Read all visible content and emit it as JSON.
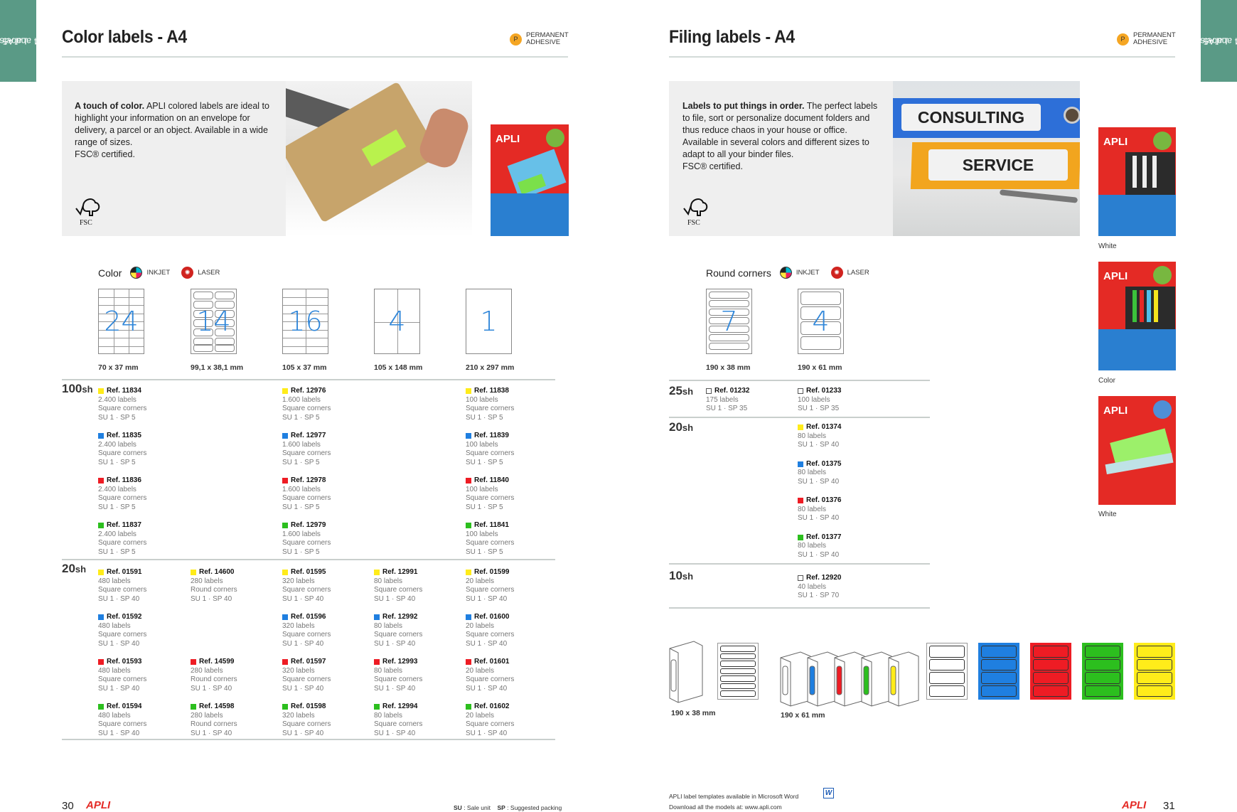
{
  "side_tabs": {
    "left": [
      "Labels",
      "A4 and A5"
    ],
    "right": [
      "Labels",
      "A4 and A5"
    ]
  },
  "colors": {
    "yellow": "#ffec1a",
    "blue": "#1f7fe0",
    "red": "#ee1c24",
    "green": "#2cbf1e",
    "accent_green": "#5a9a86",
    "brand_red": "#e42a25",
    "number_blue": "#2f86d9"
  },
  "left_page": {
    "title": "Color labels - A4",
    "adhesive_badge": {
      "icon": "P",
      "line1": "PERMANENT",
      "line2": "ADHESIVE"
    },
    "hero": {
      "lead": "A touch of color.",
      "body": " APLI colored labels are ideal to highlight your information on an envelope for delivery, a parcel or an object. Available in a wide range of sizes.",
      "certified": "FSC® certified.",
      "fsc_text": "FSC",
      "pack_brand": "APLI"
    },
    "section": {
      "label": "Color",
      "inkjet": "INKJET",
      "laser": "LASER"
    },
    "formats": [
      {
        "count": "24",
        "size": "70 x 37 mm"
      },
      {
        "count": "14",
        "size": "99,1 x 38,1 mm"
      },
      {
        "count": "16",
        "size": "105 x 37 mm"
      },
      {
        "count": "4",
        "size": "105 x 148 mm"
      },
      {
        "count": "1",
        "size": "210 x 297 mm"
      }
    ],
    "groups": [
      {
        "sheets": "100",
        "unit": "sh",
        "columns": [
          [
            {
              "color": "yellow",
              "ref": "Ref. 11834",
              "labels": "2.400 labels",
              "corners": "Square corners",
              "pack": "SU 1 · SP 5"
            },
            {
              "color": "blue",
              "ref": "Ref. 11835",
              "labels": "2.400 labels",
              "corners": "Square corners",
              "pack": "SU 1 · SP 5"
            },
            {
              "color": "red",
              "ref": "Ref. 11836",
              "labels": "2.400 labels",
              "corners": "Square corners",
              "pack": "SU 1 · SP 5"
            },
            {
              "color": "green",
              "ref": "Ref. 11837",
              "labels": "2.400 labels",
              "corners": "Square corners",
              "pack": "SU 1 · SP 5"
            }
          ],
          [],
          [
            {
              "color": "yellow",
              "ref": "Ref. 12976",
              "labels": "1.600 labels",
              "corners": "Square corners",
              "pack": "SU 1 · SP 5"
            },
            {
              "color": "blue",
              "ref": "Ref. 12977",
              "labels": "1.600 labels",
              "corners": "Square corners",
              "pack": "SU 1 · SP 5"
            },
            {
              "color": "red",
              "ref": "Ref. 12978",
              "labels": "1.600 labels",
              "corners": "Square corners",
              "pack": "SU 1 · SP 5"
            },
            {
              "color": "green",
              "ref": "Ref. 12979",
              "labels": "1.600 labels",
              "corners": "Square corners",
              "pack": "SU 1 · SP 5"
            }
          ],
          [],
          [
            {
              "color": "yellow",
              "ref": "Ref. 11838",
              "labels": "100 labels",
              "corners": "Square corners",
              "pack": "SU 1 · SP 5"
            },
            {
              "color": "blue",
              "ref": "Ref. 11839",
              "labels": "100 labels",
              "corners": "Square corners",
              "pack": "SU 1 · SP 5"
            },
            {
              "color": "red",
              "ref": "Ref. 11840",
              "labels": "100 labels",
              "corners": "Square corners",
              "pack": "SU 1 · SP 5"
            },
            {
              "color": "green",
              "ref": "Ref. 11841",
              "labels": "100 labels",
              "corners": "Square corners",
              "pack": "SU 1 · SP 5"
            }
          ]
        ]
      },
      {
        "sheets": "20",
        "unit": "sh",
        "columns": [
          [
            {
              "color": "yellow",
              "ref": "Ref. 01591",
              "labels": "480 labels",
              "corners": "Square corners",
              "pack": "SU 1 · SP 40"
            },
            {
              "color": "blue",
              "ref": "Ref. 01592",
              "labels": "480 labels",
              "corners": "Square corners",
              "pack": "SU 1 · SP 40"
            },
            {
              "color": "red",
              "ref": "Ref. 01593",
              "labels": "480 labels",
              "corners": "Square corners",
              "pack": "SU 1 · SP 40"
            },
            {
              "color": "green",
              "ref": "Ref. 01594",
              "labels": "480 labels",
              "corners": "Square corners",
              "pack": "SU 1 · SP 40"
            }
          ],
          [
            {
              "color": "yellow",
              "ref": "Ref. 14600",
              "labels": "280 labels",
              "corners": "Round corners",
              "pack": "SU 1 · SP 40"
            },
            null,
            {
              "color": "red",
              "ref": "Ref. 14599",
              "labels": "280 labels",
              "corners": "Round corners",
              "pack": "SU 1 · SP 40"
            },
            {
              "color": "green",
              "ref": "Ref. 14598",
              "labels": "280 labels",
              "corners": "Round corners",
              "pack": "SU 1 · SP 40"
            }
          ],
          [
            {
              "color": "yellow",
              "ref": "Ref. 01595",
              "labels": "320 labels",
              "corners": "Square corners",
              "pack": "SU 1 · SP 40"
            },
            {
              "color": "blue",
              "ref": "Ref. 01596",
              "labels": "320 labels",
              "corners": "Square corners",
              "pack": "SU 1 · SP 40"
            },
            {
              "color": "red",
              "ref": "Ref. 01597",
              "labels": "320 labels",
              "corners": "Square corners",
              "pack": "SU 1 · SP 40"
            },
            {
              "color": "green",
              "ref": "Ref. 01598",
              "labels": "320 labels",
              "corners": "Square corners",
              "pack": "SU 1 · SP 40"
            }
          ],
          [
            {
              "color": "yellow",
              "ref": "Ref. 12991",
              "labels": "80 labels",
              "corners": "Square corners",
              "pack": "SU 1 · SP 40"
            },
            {
              "color": "blue",
              "ref": "Ref. 12992",
              "labels": "80 labels",
              "corners": "Square corners",
              "pack": "SU 1 · SP 40"
            },
            {
              "color": "red",
              "ref": "Ref. 12993",
              "labels": "80 labels",
              "corners": "Square corners",
              "pack": "SU 1 · SP 40"
            },
            {
              "color": "green",
              "ref": "Ref. 12994",
              "labels": "80 labels",
              "corners": "Square corners",
              "pack": "SU 1 · SP 40"
            }
          ],
          [
            {
              "color": "yellow",
              "ref": "Ref. 01599",
              "labels": "20 labels",
              "corners": "Square corners",
              "pack": "SU 1 · SP 40"
            },
            {
              "color": "blue",
              "ref": "Ref. 01600",
              "labels": "20 labels",
              "corners": "Square corners",
              "pack": "SU 1 · SP 40"
            },
            {
              "color": "red",
              "ref": "Ref. 01601",
              "labels": "20 labels",
              "corners": "Square corners",
              "pack": "SU 1 · SP 40"
            },
            {
              "color": "green",
              "ref": "Ref. 01602",
              "labels": "20 labels",
              "corners": "Square corners",
              "pack": "SU 1 · SP 40"
            }
          ]
        ]
      }
    ],
    "footer": {
      "page_number": "30",
      "brand": "APLI",
      "su_key": "SU",
      "su_text": ": Sale unit",
      "sp_key": "SP",
      "sp_text": ": Suggested packing"
    }
  },
  "right_page": {
    "title": "Filing labels - A4",
    "adhesive_badge": {
      "icon": "P",
      "line1": "PERMANENT",
      "line2": "ADHESIVE"
    },
    "hero": {
      "lead": "Labels to put things in order.",
      "body": " The perfect labels to file, sort or personalize document folders and thus reduce chaos in your house or office. Available in several colors and different sizes to adapt to all your binder files.",
      "certified": "FSC® certified.",
      "fsc_text": "FSC",
      "photo_label_1": "CONSULTING",
      "photo_label_2": "SERVICE"
    },
    "packs": [
      {
        "brand": "APLI",
        "caption": "White"
      },
      {
        "brand": "APLI",
        "caption": "Color"
      },
      {
        "brand": "APLI",
        "caption": "White"
      }
    ],
    "section": {
      "label": "Round corners",
      "inkjet": "INKJET",
      "laser": "LASER"
    },
    "formats": [
      {
        "count": "7",
        "size": "190 x 38 mm"
      },
      {
        "count": "4",
        "size": "190 x 61 mm"
      }
    ],
    "groups": [
      {
        "sheets": "25",
        "unit": "sh",
        "columns": [
          [
            {
              "color": "white",
              "ref": "Ref. 01232",
              "labels": "175 labels",
              "pack": "SU 1 · SP 35"
            }
          ],
          [
            {
              "color": "white",
              "ref": "Ref. 01233",
              "labels": "100 labels",
              "pack": "SU 1 · SP 35"
            }
          ]
        ]
      },
      {
        "sheets": "20",
        "unit": "sh",
        "columns": [
          [],
          [
            {
              "color": "yellow",
              "ref": "Ref. 01374",
              "labels": "80 labels",
              "pack": "SU 1 · SP 40"
            },
            {
              "color": "blue",
              "ref": "Ref. 01375",
              "labels": "80 labels",
              "pack": "SU 1 · SP 40"
            },
            {
              "color": "red",
              "ref": "Ref. 01376",
              "labels": "80 labels",
              "pack": "SU 1 · SP 40"
            },
            {
              "color": "green",
              "ref": "Ref. 01377",
              "labels": "80 labels",
              "pack": "SU 1 · SP 40"
            }
          ]
        ]
      },
      {
        "sheets": "10",
        "unit": "sh",
        "columns": [
          [],
          [
            {
              "color": "white",
              "ref": "Ref. 12920",
              "labels": "40 labels",
              "pack": "SU 1 · SP 70"
            }
          ]
        ]
      }
    ],
    "illustrations": {
      "size_a": "190 x 38 mm",
      "size_b": "190 x 61 mm",
      "sheet_colors": [
        "white",
        "blue",
        "red",
        "green",
        "yellow"
      ]
    },
    "footer": {
      "page_number": "31",
      "brand": "APLI",
      "templates_line": "APLI label templates available in Microsoft Word",
      "download_line": "Download all the models at: www.apli.com",
      "word_icon": "W"
    }
  }
}
